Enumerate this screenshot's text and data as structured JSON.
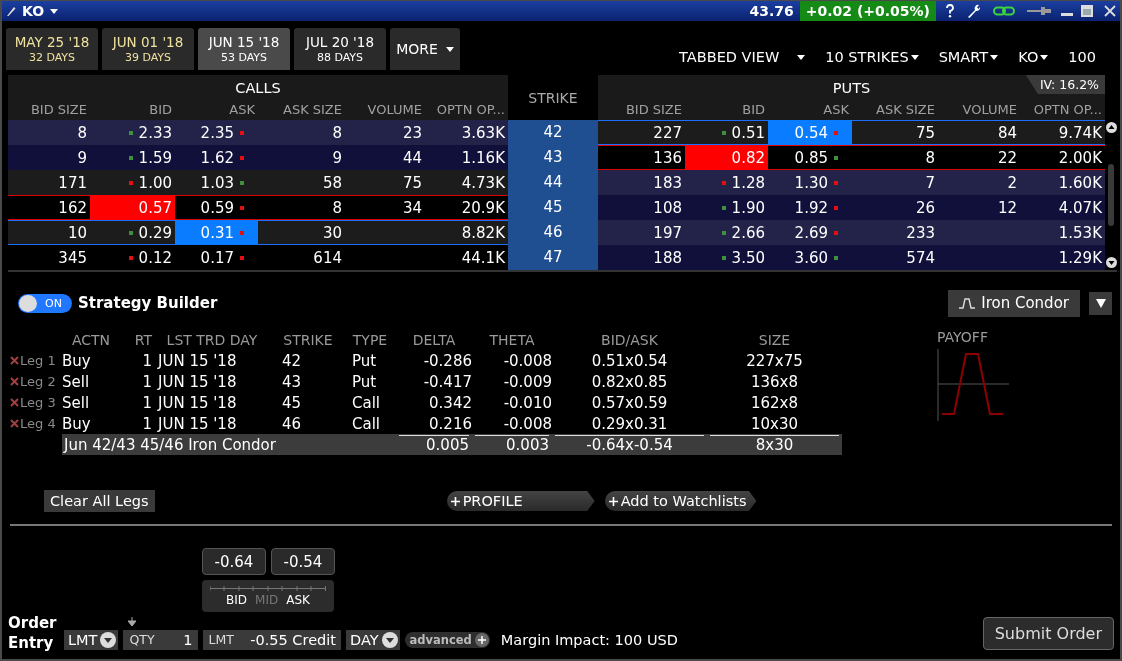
{
  "title_bar": {
    "symbol": "KO",
    "price": "43.76",
    "change": "+0.02 (+0.05%)"
  },
  "expiry_tabs": [
    {
      "date": "MAY 25 '18",
      "days": "32 DAYS",
      "selected": false,
      "color": "#efe2a0"
    },
    {
      "date": "JUN 01 '18",
      "days": "39 DAYS",
      "selected": false,
      "color": "#efe2a0"
    },
    {
      "date": "JUN 15 '18",
      "days": "53 DAYS",
      "selected": true,
      "color": "#ffffff"
    },
    {
      "date": "JUL 20 '18",
      "days": "88 DAYS",
      "selected": false,
      "color": "#ffffff"
    }
  ],
  "more_button": "MORE",
  "view_controls": [
    "TABBED VIEW",
    "10 STRIKES",
    "SMART",
    "KO"
  ],
  "multiplier": "100",
  "option_chain": {
    "calls_title": "CALLS",
    "puts_title": "PUTS",
    "strike_title": "STRIKE",
    "iv": "IV: 16.2%",
    "call_columns": [
      "BID SIZE",
      "BID",
      "ASK",
      "ASK SIZE",
      "VOLUME",
      "OPTN OP..."
    ],
    "put_columns": [
      "BID SIZE",
      "BID",
      "ASK",
      "ASK SIZE",
      "VOLUME",
      "OPTN OP..."
    ],
    "rows": [
      {
        "strike": "42",
        "call": {
          "bid_size": "8",
          "bid": "2.33",
          "bid_tick": {
            "color": "#3f8f3f"
          },
          "ask": "2.35",
          "ask_tick": {
            "color": "#e21010"
          },
          "ask_size": "8",
          "volume": "23",
          "open_interest": "3.63K",
          "in_the_money": true,
          "bid_selected": false,
          "ask_selected": false
        },
        "put": {
          "bid_size": "227",
          "bid": "0.51",
          "bid_tick": {
            "color": "#3f8f3f"
          },
          "ask": "0.54",
          "ask_tick": {
            "color": "#e21010"
          },
          "ask_size": "75",
          "volume": "84",
          "open_interest": "9.74K",
          "in_the_money": false,
          "bid_selected": false,
          "ask_selected": true
        }
      },
      {
        "strike": "43",
        "call": {
          "bid_size": "9",
          "bid": "1.59",
          "bid_tick": {
            "color": "#3f8f3f"
          },
          "ask": "1.62",
          "ask_tick": {
            "color": "#e21010"
          },
          "ask_size": "9",
          "volume": "44",
          "open_interest": "1.16K",
          "in_the_money": true,
          "bid_selected": false,
          "ask_selected": false
        },
        "put": {
          "bid_size": "136",
          "bid": "0.82",
          "ask": "0.85",
          "ask_tick": {
            "color": "#3f8f3f"
          },
          "ask_size": "8",
          "volume": "22",
          "open_interest": "2.00K",
          "in_the_money": false,
          "bid_selected": true,
          "ask_selected": false
        }
      },
      {
        "strike": "44",
        "call": {
          "bid_size": "171",
          "bid": "1.00",
          "bid_tick": {
            "color": "#e21010"
          },
          "ask": "1.03",
          "ask_tick": {
            "color": "#3f8f3f"
          },
          "ask_size": "58",
          "volume": "75",
          "open_interest": "4.73K",
          "in_the_money": false,
          "bid_selected": false,
          "ask_selected": false
        },
        "put": {
          "bid_size": "183",
          "bid": "1.28",
          "bid_tick": {
            "color": "#e21010"
          },
          "ask": "1.30",
          "ask_tick": {
            "color": "#e21010"
          },
          "ask_size": "7",
          "volume": "2",
          "open_interest": "1.60K",
          "in_the_money": true,
          "bid_selected": false,
          "ask_selected": false
        }
      },
      {
        "strike": "45",
        "call": {
          "bid_size": "162",
          "bid": "0.57",
          "ask": "0.59",
          "ask_tick": {
            "color": "#e21010"
          },
          "ask_size": "8",
          "volume": "34",
          "open_interest": "20.9K",
          "in_the_money": false,
          "bid_selected": true,
          "ask_selected": false
        },
        "put": {
          "bid_size": "108",
          "bid": "1.90",
          "bid_tick": {
            "color": "#3f8f3f"
          },
          "ask": "1.92",
          "ask_tick": {
            "color": "#e21010"
          },
          "ask_size": "26",
          "volume": "12",
          "open_interest": "4.07K",
          "in_the_money": true,
          "bid_selected": false,
          "ask_selected": false
        }
      },
      {
        "strike": "46",
        "call": {
          "bid_size": "10",
          "bid": "0.29",
          "bid_tick": {
            "color": "#3f8f3f"
          },
          "ask": "0.31",
          "ask_tick": {
            "color": "#e21010"
          },
          "ask_size": "30",
          "open_interest": "8.82K",
          "in_the_money": false,
          "bid_selected": false,
          "ask_selected": true
        },
        "put": {
          "bid_size": "197",
          "bid": "2.66",
          "bid_tick": {
            "color": "#3f8f3f"
          },
          "ask": "2.69",
          "ask_tick": {
            "color": "#e21010"
          },
          "ask_size": "233",
          "open_interest": "1.53K",
          "in_the_money": true,
          "bid_selected": false,
          "ask_selected": false
        }
      },
      {
        "strike": "47",
        "call": {
          "bid_size": "345",
          "bid": "0.12",
          "bid_tick": {
            "color": "#e21010"
          },
          "ask": "0.17",
          "ask_tick": {
            "color": "#e21010"
          },
          "ask_size": "614",
          "open_interest": "44.1K",
          "in_the_money": false,
          "bid_selected": false,
          "ask_selected": false
        },
        "put": {
          "bid_size": "188",
          "bid": "3.50",
          "bid_tick": {
            "color": "#3f8f3f"
          },
          "ask": "3.60",
          "ask_tick": {
            "color": "#3f8f3f"
          },
          "ask_size": "574",
          "open_interest": "1.29K",
          "in_the_money": true,
          "bid_selected": false,
          "ask_selected": false
        }
      }
    ]
  },
  "strategy_builder": {
    "enabled": true,
    "toggle_label": "ON",
    "title": "Strategy Builder",
    "strategy": "Iron Condor",
    "columns": [
      "ACTN",
      "RT",
      "LST TRD DAY",
      "STRIKE",
      "TYPE",
      "DELTA",
      "THETA",
      "BID/ASK",
      "SIZE"
    ],
    "legs": [
      {
        "label": "Leg 1",
        "action": "Buy",
        "ratio": "1",
        "last_trade_day": "JUN 15 '18",
        "strike": "42",
        "type": "Put",
        "delta": "-0.286",
        "theta": "-0.008",
        "bid_ask": "0.51x0.54",
        "size": "227x75"
      },
      {
        "label": "Leg 2",
        "action": "Sell",
        "ratio": "1",
        "last_trade_day": "JUN 15 '18",
        "strike": "43",
        "type": "Put",
        "delta": "-0.417",
        "theta": "-0.009",
        "bid_ask": "0.82x0.85",
        "size": "136x8"
      },
      {
        "label": "Leg 3",
        "action": "Sell",
        "ratio": "1",
        "last_trade_day": "JUN 15 '18",
        "strike": "45",
        "type": "Call",
        "delta": "0.342",
        "theta": "-0.010",
        "bid_ask": "0.57x0.59",
        "size": "162x8"
      },
      {
        "label": "Leg 4",
        "action": "Buy",
        "ratio": "1",
        "last_trade_day": "JUN 15 '18",
        "strike": "46",
        "type": "Call",
        "delta": "0.216",
        "theta": "-0.008",
        "bid_ask": "0.29x0.31",
        "size": "10x30"
      }
    ],
    "total": {
      "description": "Jun 42/43 45/46 Iron Condor",
      "delta": "0.005",
      "theta": "0.003",
      "bid_ask": "-0.64x-0.54",
      "size": "8x30"
    },
    "payoff_title": "PAYOFF",
    "buttons": [
      "Clear All Legs",
      "PROFILE",
      "Add to Watchlists"
    ]
  },
  "order_entry": {
    "label": "Order Entry",
    "price_chips": [
      "-0.64",
      "-0.54"
    ],
    "slider_labels": [
      {
        "text": "BID",
        "active": true
      },
      {
        "text": "MID",
        "active": false
      },
      {
        "text": "ASK",
        "active": true
      }
    ],
    "order_type": "LMT",
    "qty_label": "QTY",
    "qty": "1",
    "limit_label": "LMT",
    "limit_price": "-0.55 Credit",
    "time_in_force": "DAY",
    "advanced": "advanced",
    "margin_impact": "Margin Impact: 100 USD",
    "submit": "Submit Order"
  }
}
